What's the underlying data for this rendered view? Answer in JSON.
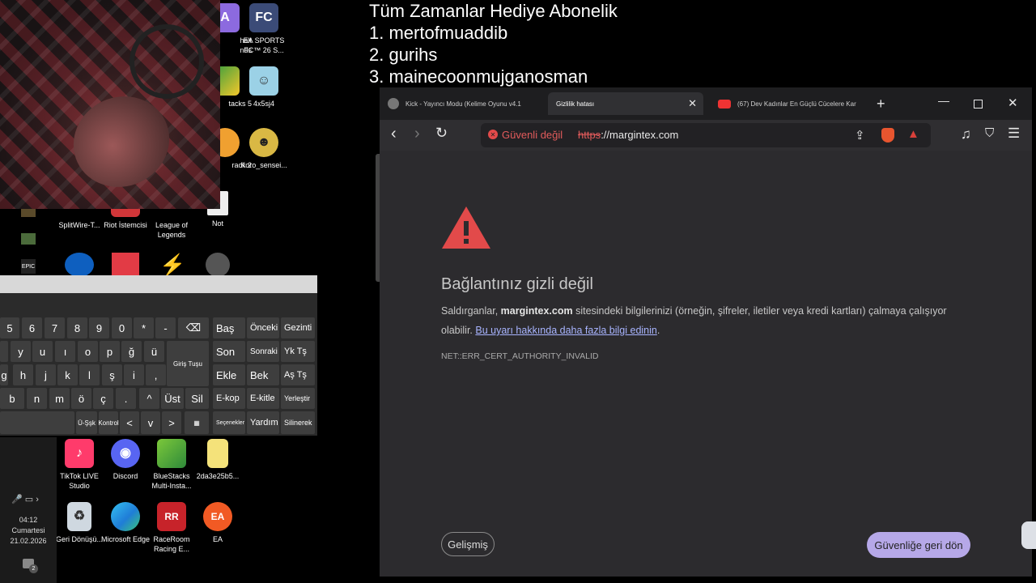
{
  "overlay": {
    "title": "Tüm Zamanlar Hediye  Abonelik",
    "lines": [
      "1. mertofmuaddib",
      "2. gurihs",
      "3. mainecoonmujganosman"
    ]
  },
  "desktop": {
    "icons": [
      {
        "label": "halt\nnds"
      },
      {
        "label": "EA SPORTS FC™ 26 S..."
      },
      {
        "label": "tacks 5"
      },
      {
        "label": "4x5sj4"
      },
      {
        "label": "rack 2"
      },
      {
        "label": "Koro_sensei..."
      },
      {
        "label": "SplitWire-T..."
      },
      {
        "label": "Riot İstemcisi"
      },
      {
        "label": "League of Legends"
      },
      {
        "label": "Not"
      },
      {
        "label": "EPIC"
      },
      {
        "label": "TikTok LIVE Studio"
      },
      {
        "label": "Discord"
      },
      {
        "label": "BlueStacks Multi-Insta..."
      },
      {
        "label": "2da3e25b5..."
      },
      {
        "label": "Geri Dönüşü..."
      },
      {
        "label": "Microsoft Edge"
      },
      {
        "label": "RaceRoom Racing E..."
      },
      {
        "label": "EA"
      }
    ]
  },
  "keyboard": {
    "row1": [
      "5",
      "6",
      "7",
      "8",
      "9",
      "0",
      "*",
      "-",
      "⌫"
    ],
    "row2": [
      "y",
      "u",
      "ı",
      "o",
      "p",
      "ğ",
      "ü",
      "Giriş Tuşu"
    ],
    "row3": [
      "g",
      "h",
      "j",
      "k",
      "l",
      "ş",
      "i",
      ","
    ],
    "row4": [
      "b",
      "n",
      "m",
      "ö",
      "ç",
      ".",
      "^",
      "Üst",
      "Sil"
    ],
    "row5": [
      "Ü-Şşk",
      "Kontrol",
      "<",
      "v",
      ">",
      "▦"
    ],
    "nav": [
      [
        "Baş",
        "Önceki",
        "Gezinti"
      ],
      [
        "Son",
        "Sonraki",
        "Yk Tş"
      ],
      [
        "Ekle",
        "Bek",
        "Aş Tş"
      ],
      [
        "E-kop",
        "E-kitle",
        "Yerleştir"
      ],
      [
        "Seçenekler",
        "Yardım",
        "Silinerek"
      ]
    ]
  },
  "taskbar": {
    "time": "04:12",
    "day": "Cumartesi",
    "date": "21.02.2026",
    "notif_count": "2"
  },
  "browser": {
    "tabs": [
      {
        "label": "Kick - Yayıncı Modu (Kelime Oyunu v4.1"
      },
      {
        "label": "Gizlilik hatası"
      },
      {
        "label": "(67) Dev Kadınlar En Güçlü Cücelere Kar"
      }
    ],
    "security_label": "Güvenli değil",
    "url_scheme": "https",
    "url_rest": "://margintex.com",
    "error": {
      "heading": "Bağlantınız gizli değil",
      "body_prefix": "Saldırganlar, ",
      "body_domain": "margintex.com",
      "body_suffix": " sitesindeki bilgilerinizi (örneğin, şifreler, iletiler veya kredi kartları) çalmaya çalışıyor olabilir. ",
      "learn_more": "Bu uyarı hakkında daha fazla bilgi edinin",
      "code": "NET::ERR_CERT_AUTHORITY_INVALID",
      "advanced_button": "Gelişmiş",
      "back_button": "Güvenliğe geri dön"
    },
    "colors": {
      "warning": "#e24a4a",
      "link": "#a8b4ff",
      "back_btn_bg": "#b6a8e8"
    }
  }
}
